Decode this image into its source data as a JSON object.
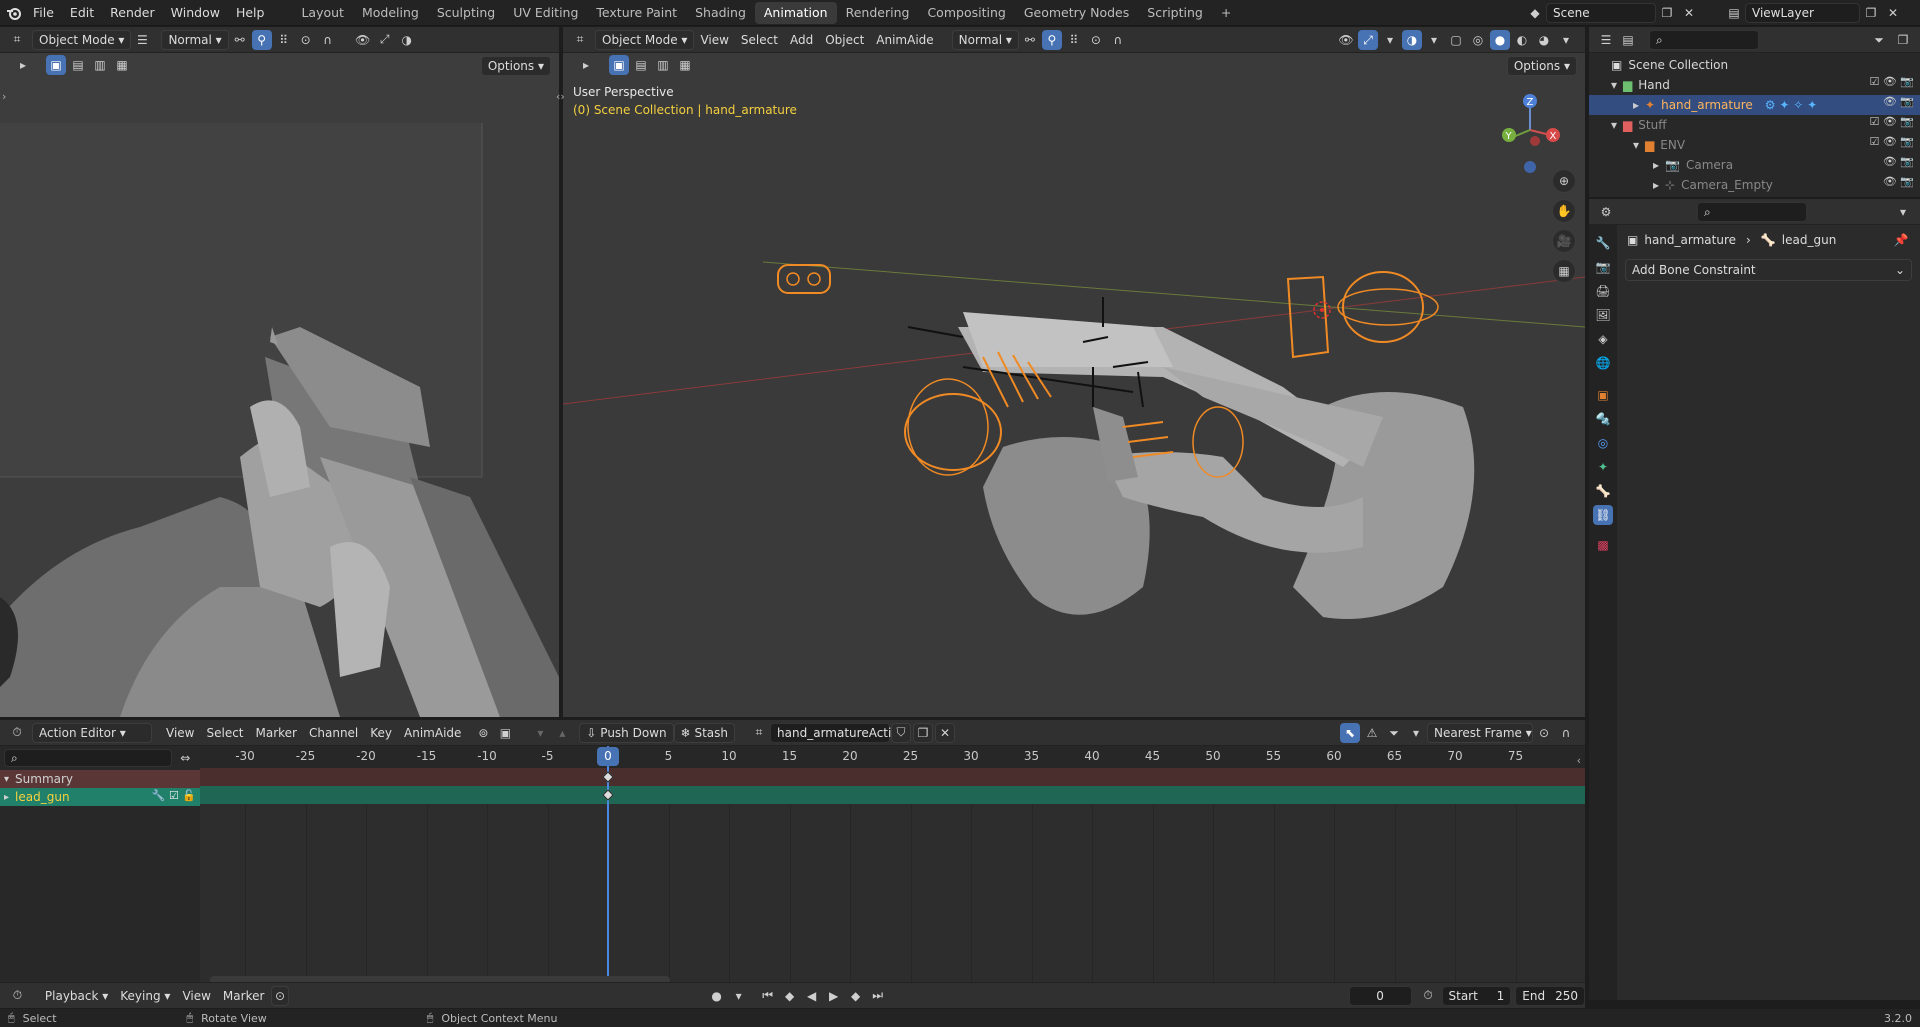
{
  "menu": {
    "items": [
      "File",
      "Edit",
      "Render",
      "Window",
      "Help"
    ]
  },
  "workspaces": [
    {
      "label": "Layout",
      "active": false
    },
    {
      "label": "Modeling",
      "active": false
    },
    {
      "label": "Sculpting",
      "active": false
    },
    {
      "label": "UV Editing",
      "active": false
    },
    {
      "label": "Texture Paint",
      "active": false
    },
    {
      "label": "Shading",
      "active": false
    },
    {
      "label": "Animation",
      "active": true
    },
    {
      "label": "Rendering",
      "active": false
    },
    {
      "label": "Compositing",
      "active": false
    },
    {
      "label": "Geometry Nodes",
      "active": false
    },
    {
      "label": "Scripting",
      "active": false
    }
  ],
  "add_workspace": "+",
  "scene": {
    "name": "Scene",
    "view_layer": "ViewLayer"
  },
  "left_view": {
    "mode": "Object Mode",
    "orientation": "Normal",
    "options": "Options"
  },
  "main_view": {
    "mode": "Object Mode",
    "menus": [
      "View",
      "Select",
      "Add",
      "Object",
      "AnimAide"
    ],
    "orientation": "Normal",
    "options": "Options",
    "perspective": "User Perspective",
    "context": "(0) Scene Collection | hand_armature"
  },
  "outliner": {
    "root": "Scene Collection",
    "rows": [
      {
        "label": "Hand",
        "depth": 1,
        "type": "collection",
        "selected": false
      },
      {
        "label": "hand_armature",
        "depth": 2,
        "type": "armature",
        "selected": true
      },
      {
        "label": "Stuff",
        "depth": 1,
        "type": "collection",
        "selected": false
      },
      {
        "label": "ENV",
        "depth": 2,
        "type": "collection",
        "selected": false
      },
      {
        "label": "Camera",
        "depth": 3,
        "type": "camera",
        "selected": false
      },
      {
        "label": "Camera_Empty",
        "depth": 3,
        "type": "empty",
        "selected": false
      }
    ]
  },
  "properties": {
    "object": "hand_armature",
    "bone": "lead_gun",
    "add_constraint": "Add Bone Constraint"
  },
  "action_editor": {
    "mode": "Action Editor",
    "menus": [
      "View",
      "Select",
      "Marker",
      "Channel",
      "Key",
      "AnimAide"
    ],
    "push_down": "Push Down",
    "stash": "Stash",
    "action_name": "hand_armatureAction",
    "snap": "Nearest Frame",
    "channels": [
      {
        "label": "Summary",
        "type": "summary"
      },
      {
        "label": "lead_gun",
        "type": "group"
      }
    ],
    "ruler": [
      -30,
      -25,
      -20,
      -15,
      -10,
      -5,
      0,
      5,
      10,
      15,
      20,
      25,
      30,
      35,
      40,
      45,
      50,
      55,
      60,
      65,
      70,
      75
    ],
    "current_frame": 0
  },
  "timeline": {
    "menus": [
      "Playback",
      "Keying",
      "View",
      "Marker"
    ],
    "frame": "0",
    "start_label": "Start",
    "start": "1",
    "end_label": "End",
    "end": "250"
  },
  "status": {
    "items": [
      "Select",
      "Rotate View",
      "Object Context Menu"
    ],
    "version": "3.2.0"
  }
}
